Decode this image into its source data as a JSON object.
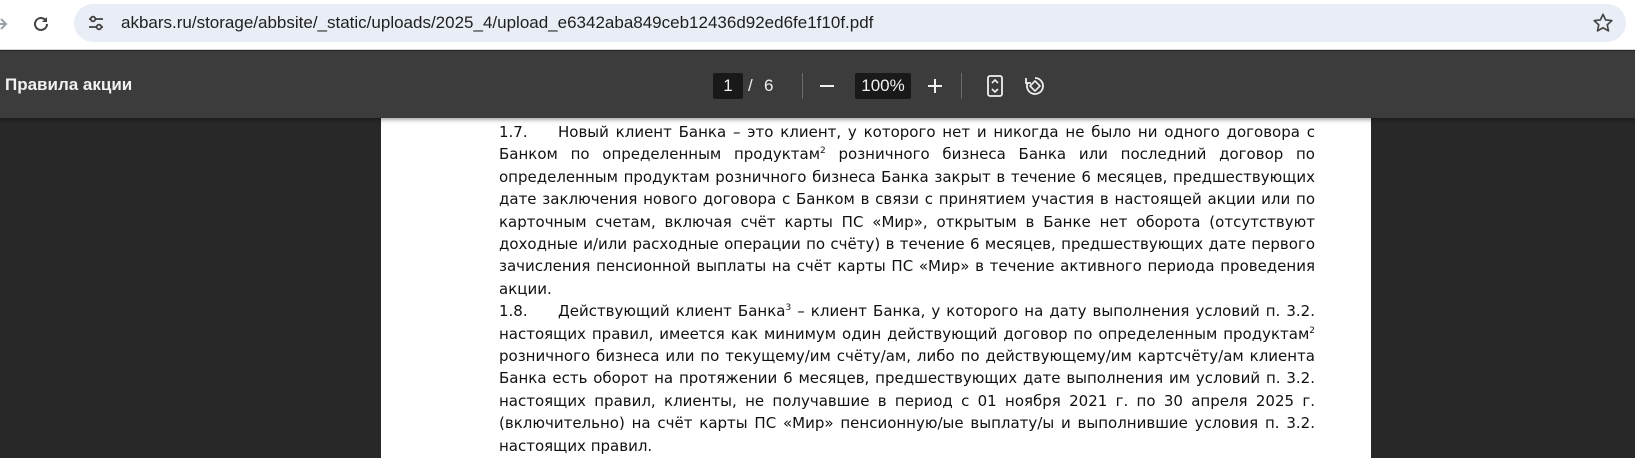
{
  "browser": {
    "url": "akbars.ru/storage/abbsite/_static/uploads/2025_4/upload_e6342aba849ceb12436d92ed6fe1f10f.pdf"
  },
  "pdf_toolbar": {
    "title": "Правила акции",
    "current_page": "1",
    "page_separator": "/",
    "total_pages": "6",
    "zoom": "100%"
  },
  "document": {
    "p17": {
      "number": "1.7.",
      "text_a": "Новый клиент Банка – это клиент, у которого нет и никогда не было ни одного договора с Банком по определенным продуктам",
      "sup1": "2",
      "text_b": " розничного бизнеса Банка или последний договор по определенным продуктам розничного бизнеса Банка закрыт в течение 6 месяцев, предшествующих дате заключения нового договора с Банком в связи с принятием участия в настоящей акции или по карточным счетам, включая счёт карты ПС «Мир», открытым в Банке нет оборота (отсутствуют доходные и/или расходные операции по счёту) в течение 6 месяцев, предшествующих дате первого зачисления пенсионной выплаты на счёт карты ПС «Мир» в течение активного периода проведения акции."
    },
    "p18": {
      "number": "1.8.",
      "text_a": "Действующий клиент Банка",
      "sup1": "3",
      "text_b": " – клиент Банка, у которого на дату выполнения условий п. 3.2. настоящих правил, имеется как минимум один действующий договор по определенным продуктам",
      "sup2": "2",
      "text_c": " розничного бизнеса или по текущему/им счёту/ам, либо по действующему/им картсчёту/ам клиента Банка есть оборот на протяжении 6 месяцев, предшествующих дате выполнения им условий п. 3.2. настоящих правил, клиенты, не получавшие в период с 01 ноября 2021 г. по 30 апреля 2025 г. (включительно) на счёт карты ПС «Мир» пенсионную/ые выплату/ы и выполнившие условия п. 3.2. настоящих правил."
    }
  },
  "colors": {
    "toolbar_bg": "#3c3c3c",
    "viewer_bg": "#282828",
    "omnibox_bg": "#e9eef6"
  },
  "icons": [
    "forward-arrow-icon",
    "reload-icon",
    "site-info-icon",
    "bookmark-star-icon",
    "zoom-out-icon",
    "zoom-in-icon",
    "fit-page-icon",
    "rotate-icon"
  ]
}
